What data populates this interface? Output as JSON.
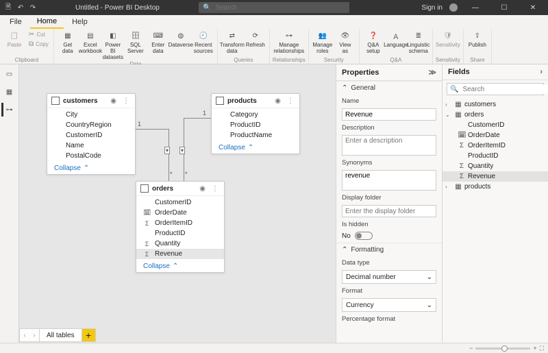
{
  "titlebar": {
    "app_title": "Untitled - Power BI Desktop",
    "search_placeholder": "Search",
    "signin": "Sign in"
  },
  "menubar": {
    "file": "File",
    "home": "Home",
    "help": "Help"
  },
  "ribbon": {
    "clipboard": {
      "paste": "Paste",
      "cut": "Cut",
      "copy": "Copy",
      "group": "Clipboard"
    },
    "data": {
      "get": "Get\ndata",
      "excel": "Excel\nworkbook",
      "pbi": "Power BI\ndatasets",
      "sql": "SQL\nServer",
      "enter": "Enter\ndata",
      "dv": "Dataverse",
      "recent": "Recent\nsources",
      "group": "Data"
    },
    "queries": {
      "transform": "Transform\ndata",
      "refresh": "Refresh",
      "group": "Queries"
    },
    "rel": {
      "manage": "Manage\nrelationships",
      "group": "Relationships"
    },
    "sec": {
      "roles": "Manage\nroles",
      "view": "View\nas",
      "group": "Security"
    },
    "qa": {
      "qa": "Q&A\nsetup",
      "lang": "Language\n",
      "ling": "Linguistic\nschema",
      "group": "Q&A"
    },
    "sens": {
      "sens": "Sensitivity\n",
      "group": "Sensitivity"
    },
    "share": {
      "publish": "Publish",
      "group": "Share"
    }
  },
  "tables": {
    "customers": {
      "name": "customers",
      "fields": [
        "City",
        "CountryRegion",
        "CustomerID",
        "Name",
        "PostalCode"
      ]
    },
    "products": {
      "name": "products",
      "fields": [
        "Category",
        "ProductID",
        "ProductName"
      ]
    },
    "orders": {
      "name": "orders",
      "fields": [
        "CustomerID",
        "OrderDate",
        "OrderItemID",
        "ProductID",
        "Quantity",
        "Revenue"
      ],
      "icons": [
        "",
        "cal",
        "sum",
        "",
        "sum",
        "sum"
      ],
      "selected": "Revenue"
    }
  },
  "collapse_label": "Collapse",
  "cardinality": {
    "one": "1",
    "many": "*"
  },
  "tabs": {
    "all": "All tables"
  },
  "properties": {
    "title": "Properties",
    "general": "General",
    "name_label": "Name",
    "name_value": "Revenue",
    "desc_label": "Description",
    "desc_placeholder": "Enter a description",
    "syn_label": "Synonyms",
    "syn_value": "revenue",
    "folder_label": "Display folder",
    "folder_placeholder": "Enter the display folder",
    "hidden_label": "Is hidden",
    "hidden_value": "No",
    "formatting": "Formatting",
    "dtype_label": "Data type",
    "dtype_value": "Decimal number",
    "format_label": "Format",
    "format_value": "Currency",
    "pct_label": "Percentage format"
  },
  "fields": {
    "title": "Fields",
    "search_placeholder": "Search",
    "customers": "customers",
    "orders": "orders",
    "products": "products",
    "order_fields": [
      "CustomerID",
      "OrderDate",
      "OrderItemID",
      "ProductID",
      "Quantity",
      "Revenue"
    ],
    "order_icons": [
      "",
      "cal",
      "sum",
      "",
      "sum",
      "sum"
    ]
  }
}
